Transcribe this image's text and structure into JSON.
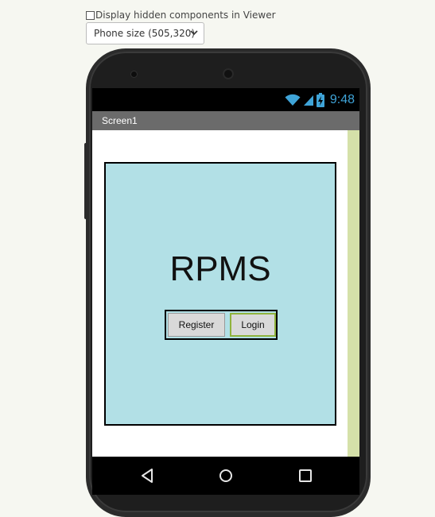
{
  "toolbar": {
    "display_hidden_label": "Display hidden components in Viewer",
    "display_hidden_checked": false,
    "size_select_value": "Phone size (505,320)"
  },
  "status_bar": {
    "time": "9:48",
    "icon_color": "#3fa4d8"
  },
  "screen": {
    "title": "Screen1"
  },
  "app": {
    "title": "RPMS",
    "register_label": "Register",
    "login_label": "Login",
    "panel_color": "#b2e0e6",
    "selected_color": "#8fb33c"
  },
  "nav": {
    "back_icon": "back-triangle-icon",
    "home_icon": "home-circle-icon",
    "recents_icon": "recents-square-icon"
  }
}
